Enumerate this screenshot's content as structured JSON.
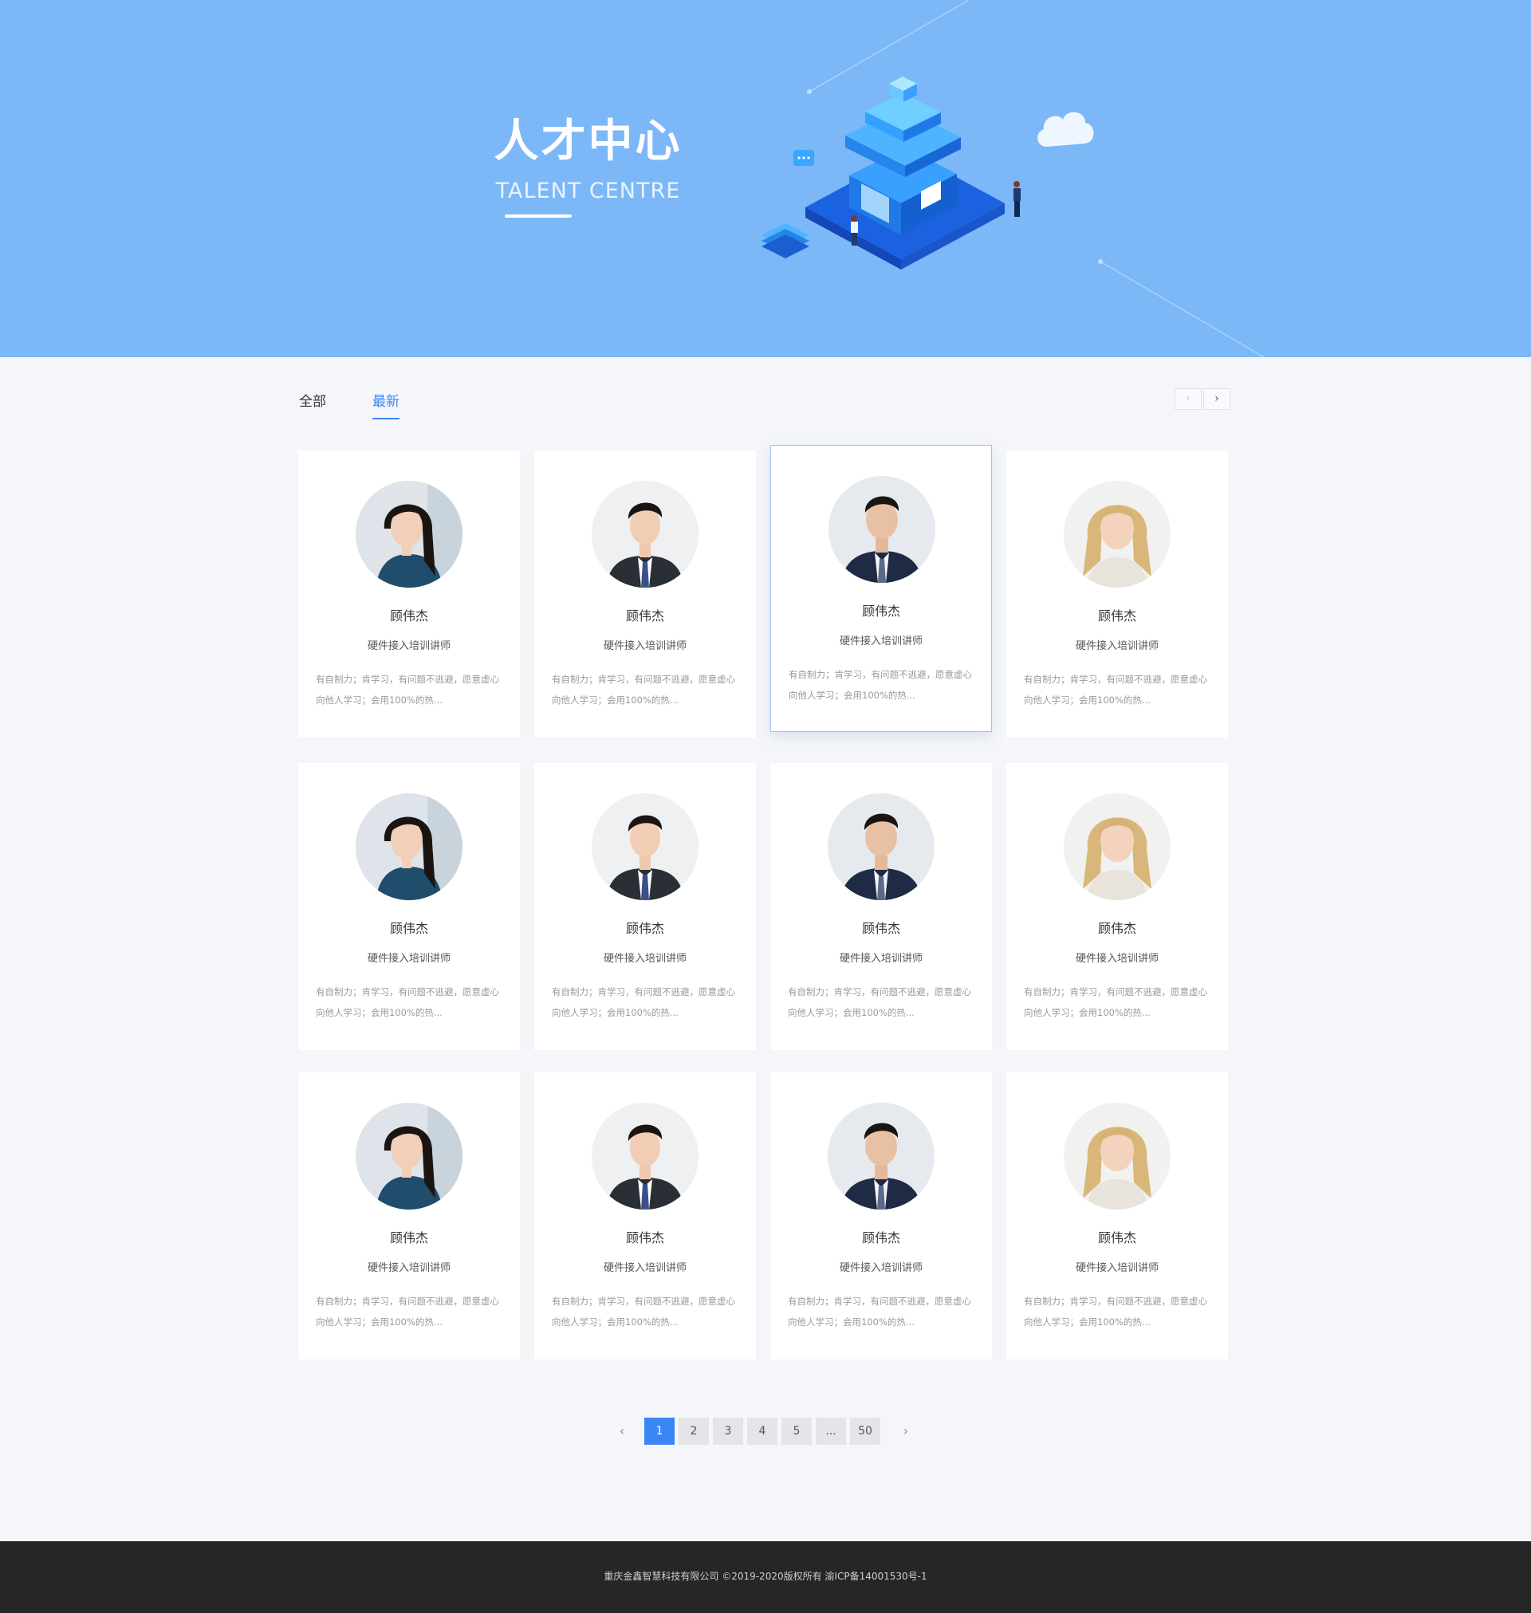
{
  "banner": {
    "title": "人才中心",
    "subtitle": "TALENT CENTRE"
  },
  "tabs": [
    {
      "label": "全部",
      "active": false
    },
    {
      "label": "最新",
      "active": true
    }
  ],
  "nav_arrows": {
    "prev": "‹",
    "next": "›"
  },
  "cards": [
    {
      "name": "顾伟杰",
      "title": "硬件接入培训讲师",
      "desc": "有自制力；肯学习，有问题不逃避，愿意虚心向他人学习；会用100%的热...",
      "avatar": "woman-dark-hair",
      "active": false
    },
    {
      "name": "顾伟杰",
      "title": "硬件接入培训讲师",
      "desc": "有自制力；肯学习，有问题不逃避，愿意虚心向他人学习；会用100%的热...",
      "avatar": "man-young-suit",
      "active": false
    },
    {
      "name": "顾伟杰",
      "title": "硬件接入培训讲师",
      "desc": "有自制力；肯学习，有问题不逃避，愿意虚心向他人学习；会用100%的热...",
      "avatar": "man-suit",
      "active": true
    },
    {
      "name": "顾伟杰",
      "title": "硬件接入培训讲师",
      "desc": "有自制力；肯学习，有问题不逃避，愿意虚心向他人学习；会用100%的热...",
      "avatar": "woman-blonde",
      "active": false
    },
    {
      "name": "顾伟杰",
      "title": "硬件接入培训讲师",
      "desc": "有自制力；肯学习，有问题不逃避，愿意虚心向他人学习；会用100%的热...",
      "avatar": "woman-dark-hair",
      "active": false
    },
    {
      "name": "顾伟杰",
      "title": "硬件接入培训讲师",
      "desc": "有自制力；肯学习，有问题不逃避，愿意虚心向他人学习；会用100%的热...",
      "avatar": "man-young-suit",
      "active": false
    },
    {
      "name": "顾伟杰",
      "title": "硬件接入培训讲师",
      "desc": "有自制力；肯学习，有问题不逃避，愿意虚心向他人学习；会用100%的热...",
      "avatar": "man-suit",
      "active": false
    },
    {
      "name": "顾伟杰",
      "title": "硬件接入培训讲师",
      "desc": "有自制力；肯学习，有问题不逃避，愿意虚心向他人学习；会用100%的热...",
      "avatar": "woman-blonde",
      "active": false
    },
    {
      "name": "顾伟杰",
      "title": "硬件接入培训讲师",
      "desc": "有自制力；肯学习，有问题不逃避，愿意虚心向他人学习；会用100%的热...",
      "avatar": "woman-dark-hair",
      "active": false
    },
    {
      "name": "顾伟杰",
      "title": "硬件接入培训讲师",
      "desc": "有自制力；肯学习，有问题不逃避，愿意虚心向他人学习；会用100%的热...",
      "avatar": "man-young-suit",
      "active": false
    },
    {
      "name": "顾伟杰",
      "title": "硬件接入培训讲师",
      "desc": "有自制力；肯学习，有问题不逃避，愿意虚心向他人学习；会用100%的热...",
      "avatar": "man-suit",
      "active": false
    },
    {
      "name": "顾伟杰",
      "title": "硬件接入培训讲师",
      "desc": "有自制力；肯学习，有问题不逃避，愿意虚心向他人学习；会用100%的热...",
      "avatar": "woman-blonde",
      "active": false
    }
  ],
  "pagination": {
    "prev": "‹",
    "next": "›",
    "pages": [
      "1",
      "2",
      "3",
      "4",
      "5",
      "...",
      "50"
    ],
    "current": "1"
  },
  "footer": {
    "text": "重庆金鑫智慧科技有限公司 ©2019-2020版权所有 渝ICP备14001530号-1"
  },
  "colors": {
    "banner_bg": "#7cb8f7",
    "accent": "#3a86f4",
    "footer_bg": "#262626"
  }
}
